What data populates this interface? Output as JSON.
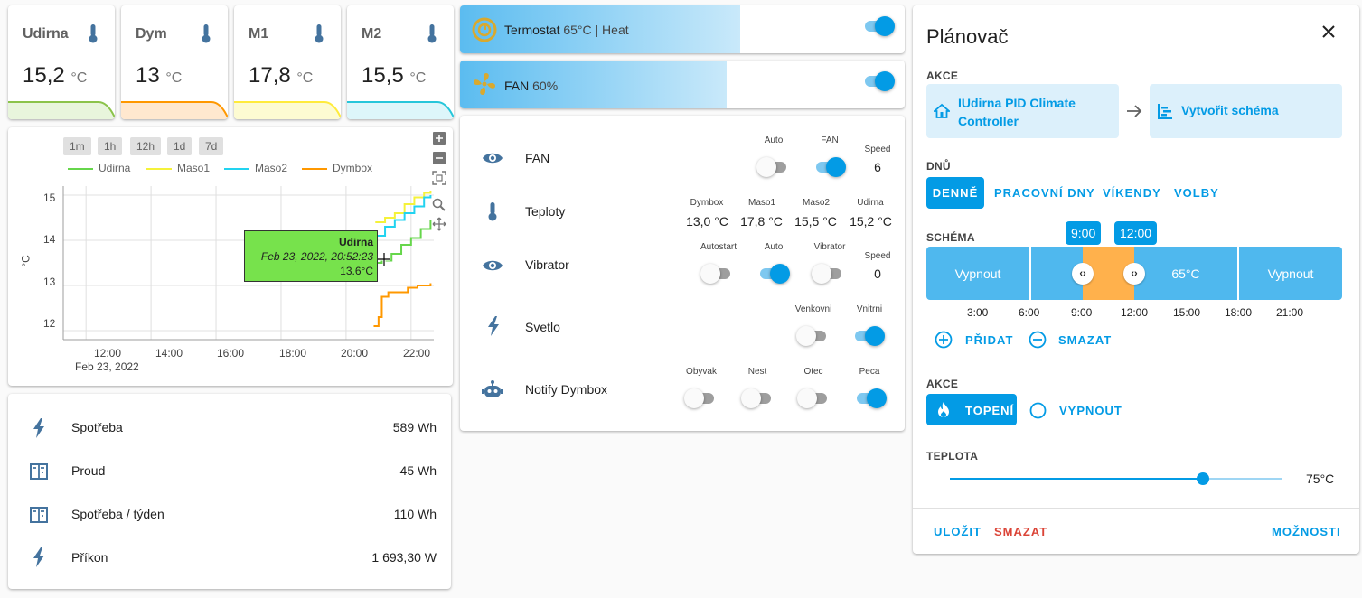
{
  "sensors": [
    {
      "name": "Udirna",
      "value": "15,2",
      "unit": "°C",
      "color": "#8bc34a",
      "fill": "#e8f5dc"
    },
    {
      "name": "Dym",
      "value": "13",
      "unit": "°C",
      "color": "#ff9800",
      "fill": "#ffe8cf"
    },
    {
      "name": "M1",
      "value": "17,8",
      "unit": "°C",
      "color": "#ffeb3b",
      "fill": "#fdfbd2"
    },
    {
      "name": "M2",
      "value": "15,5",
      "unit": "°C",
      "color": "#26c6da",
      "fill": "#ddf6fa"
    }
  ],
  "chart_controls": {
    "ranges": [
      "1m",
      "1h",
      "12h",
      "1d",
      "7d"
    ]
  },
  "chart_data": {
    "type": "line",
    "ylabel": "°C",
    "yticks": [
      "15",
      "14",
      "13",
      "12"
    ],
    "xticks": [
      "12:00",
      "14:00",
      "16:00",
      "18:00",
      "20:00",
      "22:00"
    ],
    "xdate": "Feb 23, 2022",
    "ylim": [
      11.8,
      15.2
    ],
    "grid": true,
    "series": [
      {
        "name": "Udirna",
        "color": "#66d64b",
        "points": [
          [
            20.9,
            13.5
          ],
          [
            21.1,
            13.55
          ],
          [
            21.4,
            13.7
          ],
          [
            21.7,
            13.9
          ],
          [
            22.0,
            14.05
          ],
          [
            22.3,
            14.25
          ],
          [
            22.6,
            14.45
          ]
        ]
      },
      {
        "name": "Maso1",
        "color": "#f5f23a",
        "points": [
          [
            20.9,
            14.4
          ],
          [
            21.2,
            14.5
          ],
          [
            21.5,
            14.6
          ],
          [
            21.8,
            14.8
          ],
          [
            22.1,
            14.95
          ],
          [
            22.4,
            15.05
          ],
          [
            22.6,
            15.1
          ]
        ]
      },
      {
        "name": "Maso2",
        "color": "#22d3f0",
        "points": [
          [
            20.9,
            14.1
          ],
          [
            21.2,
            14.3
          ],
          [
            21.5,
            14.45
          ],
          [
            21.8,
            14.6
          ],
          [
            22.1,
            14.75
          ],
          [
            22.4,
            14.95
          ],
          [
            22.6,
            15.0
          ]
        ]
      },
      {
        "name": "Dymbox",
        "color": "#ff9800",
        "points": [
          [
            20.85,
            12.1
          ],
          [
            21.0,
            12.3
          ],
          [
            21.1,
            12.75
          ],
          [
            21.3,
            12.85
          ],
          [
            21.6,
            12.85
          ],
          [
            21.9,
            12.95
          ],
          [
            22.2,
            13.0
          ],
          [
            22.6,
            13.05
          ]
        ]
      }
    ],
    "tooltip": {
      "title": "Udirna",
      "date": "Feb 23, 2022, 20:52:23",
      "value": "13.6°C"
    }
  },
  "energy": [
    {
      "icon": "flash-icon",
      "label": "Spotřeba",
      "value": "589 Wh"
    },
    {
      "icon": "meter-icon",
      "label": "Proud",
      "value": "45 Wh"
    },
    {
      "icon": "meter-icon",
      "label": "Spotřeba / týden",
      "value": "110 Wh"
    },
    {
      "icon": "flash-icon",
      "label": "Příkon",
      "value": "1 693,30 W"
    }
  ],
  "tiles": [
    {
      "title": "Termostat",
      "state": "65°C | Heat",
      "fill_percent": 60
    },
    {
      "title": "FAN",
      "state": "60%",
      "fill_percent": 54
    }
  ],
  "entities": {
    "fan": {
      "name": "FAN",
      "auto": "Auto",
      "fan": "FAN",
      "speed_label": "Speed",
      "speed": "6"
    },
    "temps": {
      "name": "Teploty",
      "labels": [
        "Dymbox",
        "Maso1",
        "Maso2",
        "Udirna"
      ],
      "values": [
        "13,0 °C",
        "17,8 °C",
        "15,5 °C",
        "15,2 °C"
      ]
    },
    "vibrator": {
      "name": "Vibrator",
      "autostart": "Autostart",
      "auto": "Auto",
      "vibrator": "Vibrator",
      "speed_label": "Speed",
      "speed": "0"
    },
    "light": {
      "name": "Svetlo",
      "outside": "Venkovni",
      "inside": "Vnitrni"
    },
    "notify": {
      "name": "Notify Dymbox",
      "labels": [
        "Obyvak",
        "Nest",
        "Otec",
        "Peca"
      ]
    }
  },
  "scheduler": {
    "title": "Plánovač",
    "action_label": "AKCE",
    "controller": "IUdirna PID Climate Controller",
    "create": "Vytvořit schéma",
    "days_label": "DNŮ",
    "days": [
      "DENNĚ",
      "PRACOVNÍ DNY",
      "VÍKENDY",
      "VOLBY"
    ],
    "schema_label": "SCHÉMA",
    "segments": [
      "Vypnout",
      "65°C",
      "Vypnout"
    ],
    "bubbles": [
      "9:00",
      "12:00"
    ],
    "times": [
      "3:00",
      "6:00",
      "9:00",
      "12:00",
      "15:00",
      "18:00",
      "21:00"
    ],
    "add": "PŘIDAT",
    "remove": "SMAZAT",
    "action2_label": "AKCE",
    "heat": "TOPENÍ",
    "off": "VYPNOUT",
    "temp_label": "TEPLOTA",
    "temp_value": "75°C",
    "slider_fraction": 0.76,
    "save": "ULOŽIT",
    "delete": "SMAZAT",
    "options": "MOŽNOSTI"
  }
}
